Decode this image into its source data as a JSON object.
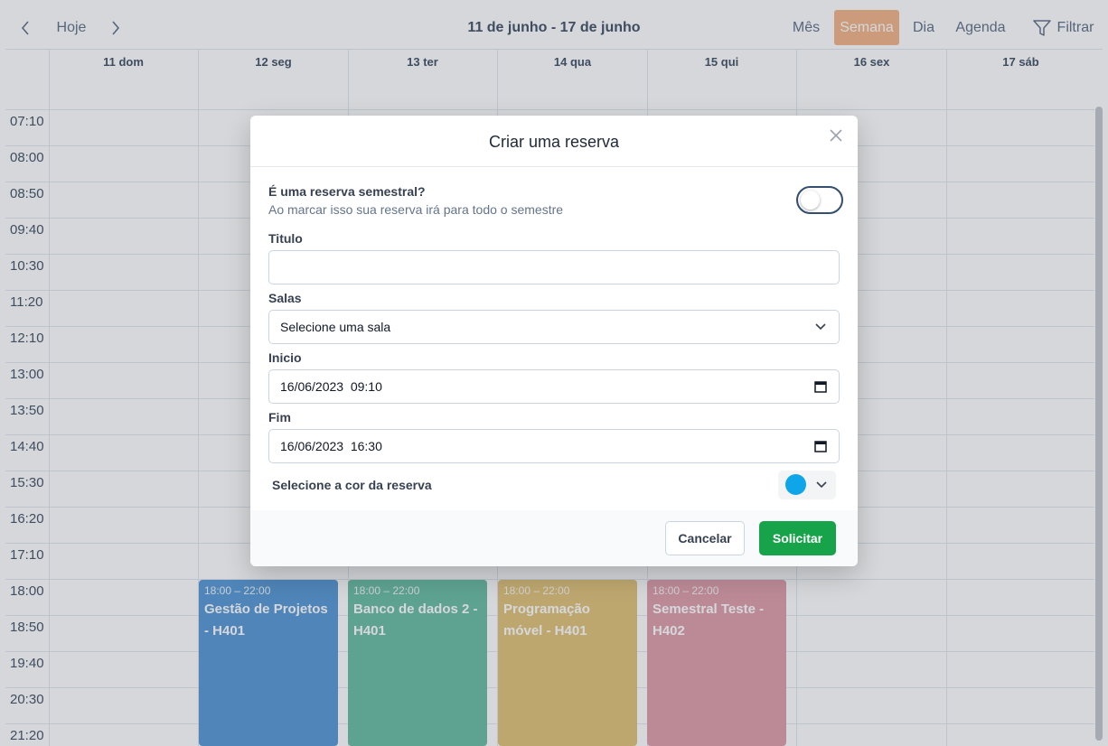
{
  "calendar": {
    "toolbar": {
      "prev_icon": "chevron-left-icon",
      "today_label": "Hoje",
      "next_icon": "chevron-right-icon",
      "range_title": "11 de junho - 17 de junho",
      "views": [
        "Mês",
        "Semana",
        "Dia",
        "Agenda"
      ],
      "active_view": "Semana",
      "filter_label": "Filtrar",
      "filter_icon": "filter-icon"
    },
    "days": [
      "11 dom",
      "12 seg",
      "13 ter",
      "14 qua",
      "15 qui",
      "16 sex",
      "17 sáb"
    ],
    "times": [
      "07:10",
      "08:00",
      "08:50",
      "09:40",
      "10:30",
      "11:20",
      "12:10",
      "13:00",
      "13:50",
      "14:40",
      "15:30",
      "16:20",
      "17:10",
      "18:00",
      "18:50",
      "19:40",
      "20:30",
      "21:20"
    ],
    "events": [
      {
        "time": "18:00 – 22:00",
        "title": "Gestão de Projetos - H401",
        "day": "12 seg",
        "color": "#5b9bd5"
      },
      {
        "time": "18:00 – 22:00",
        "title": "Banco de dados 2 - H401",
        "day": "13 ter",
        "color": "#6dbfa6"
      },
      {
        "time": "18:00 – 22:00",
        "title": "Programação móvel - H401",
        "day": "14 qua",
        "color": "#e3c47c"
      },
      {
        "time": "18:00 – 22:00",
        "title": "Semestral Teste - H402",
        "day": "15 qui",
        "color": "#e0a0ad"
      }
    ]
  },
  "modal": {
    "title": "Criar uma reserva",
    "close_icon": "close-icon",
    "semester": {
      "label": "É uma reserva semestral?",
      "help": "Ao marcar isso sua reserva irá para todo o semestre",
      "checked": false
    },
    "title_field": {
      "label": "Titulo",
      "value": "",
      "placeholder": ""
    },
    "rooms": {
      "label": "Salas",
      "value": "Selecione uma sala"
    },
    "start": {
      "label": "Inicio",
      "value": "16/06/2023  09:10"
    },
    "end": {
      "label": "Fim",
      "value": "16/06/2023  16:30"
    },
    "color": {
      "label": "Selecione a cor da reserva",
      "value": "#0ea5e9"
    },
    "buttons": {
      "cancel": "Cancelar",
      "submit": "Solicitar"
    }
  }
}
